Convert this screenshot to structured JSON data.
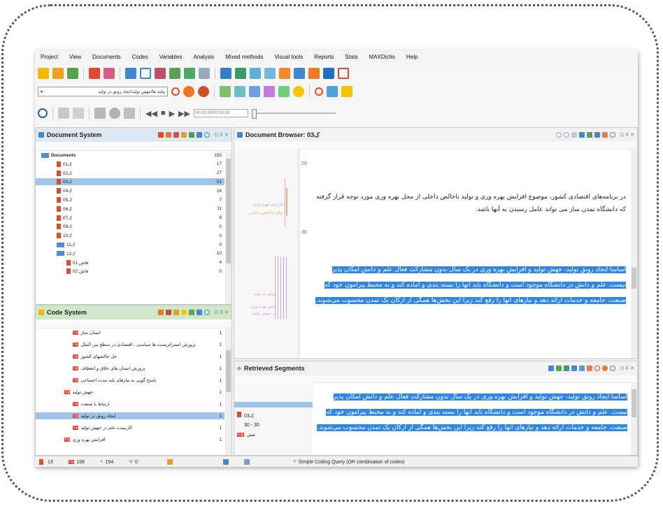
{
  "menu": [
    "Project",
    "View",
    "Documents",
    "Codes",
    "Variables",
    "Analysis",
    "Mixed methods",
    "Visual tools",
    "Reports",
    "Stats",
    "MAXDictio",
    "Help"
  ],
  "code_select": {
    "value": "پیامد ها/جهش تولید/ایجاد رونق در تولید"
  },
  "media": {
    "time": "00:00:00/00:00:00"
  },
  "document_system": {
    "title": "Document System",
    "rows": [
      {
        "label": "Documents",
        "count": "155"
      },
      {
        "label": "01ک",
        "count": "17"
      },
      {
        "label": "02ک",
        "count": "27"
      },
      {
        "label": "03ک",
        "count": "51"
      },
      {
        "label": "04ک",
        "count": "24"
      },
      {
        "label": "05ک",
        "count": "7"
      },
      {
        "label": "06ک",
        "count": "11"
      },
      {
        "label": "07ک",
        "count": "8"
      },
      {
        "label": "09ک",
        "count": "0"
      },
      {
        "label": "10ک",
        "count": "0"
      },
      {
        "label": "11ک",
        "count": "0"
      },
      {
        "label": "12ک",
        "count": "10"
      },
      {
        "label": "فاش 01",
        "count": "4"
      },
      {
        "label": "فاش 02",
        "count": "0"
      }
    ]
  },
  "code_system": {
    "title": "Code System",
    "rows": [
      {
        "label": "انسان ساز",
        "count": "1"
      },
      {
        "label": "پرورش استراتژیست ها سیاسی ، اقتصادی در سطح بین الملل",
        "count": "1"
      },
      {
        "label": "حل چالشهای کشور",
        "count": "1"
      },
      {
        "label": "پرورش انسان های خلاق و انعطاف",
        "count": "1"
      },
      {
        "label": "پاسخ گویی به نیازهای بلند مدت اجتماعی",
        "count": "1"
      },
      {
        "label": "جهش تولید",
        "count": "1"
      },
      {
        "label": "ارتباط با صنعت",
        "count": "1"
      },
      {
        "label": "ایجاد رونق در تولید",
        "count": "1"
      },
      {
        "label": "کاربست علم در جهش تولید",
        "count": "1"
      },
      {
        "label": "افزایش بهره وری",
        "count": "1"
      }
    ]
  },
  "document_browser": {
    "title": "Document Browser: 03ک",
    "para_num_1": "29",
    "para_num_2": "30",
    "paragraph_1": "در برنامه‌های اقتصادی کشور، موضوع افزایش بهره وری و تولید ناخالص داخلی از محل بهره وری مورد توجه قرار گرفته که دانشگاه تمدن ساز می تواند عامل رسیدن به آنها باشد.",
    "paragraph_2": "اساساً ایجاد رونق تولید، جهش تولید و افزایش بهره وری در یک سال بدون مشارکت فعال علم و دانش امکان پذیر نیست. علم و دانش در دانشگاه موجود است و دانشگاه باید آنها را بسته بندی و آماده کند و به محیط پیرامون خود که صنعت، جامعه و خدمات ارائه دهد و نیازهای آنها را رفع کند زیرا این بخش‌ها همگی از ارکان یک تمدن محسوب می‌شوند.",
    "code_label_1": "افزایش بهره وری",
    "code_label_2": "تولید ناخالص داخلی",
    "code_label_3": "رونق در تولید",
    "code_label_4": "نقش بهره وری",
    "code_label_5": "در جهش تولید"
  },
  "retrieved_segments": {
    "title": "Retrieved Segments",
    "doc": "03ک",
    "range": "30 - 30",
    "code_label": "نقش",
    "text": "اساساً ایجاد رونق تولید، جهش تولید و افزایش بهره وری در یک سال بدون مشارکت فعال علم و دانش امکان پذیر نیست. علم و دانش در دانشگاه موجود است و دانشگاه باید آنها را بسته بندی و آماده کند و به محیط پیرامون خود که صنعت، جامعه و خدمات ارائه دهد و نیازهای آنها را رفع کند زیرا این بخش‌ها همگی از ارکان یک تمدن محسوب می‌شوند."
  },
  "status": {
    "docs": "13",
    "codes": "158",
    "memos": "154",
    "var": "0",
    "query": "Simple Coding Query (OR combination of codes)"
  },
  "colors": {
    "accent": "#2e86e6",
    "code_red": "#e53935",
    "header_green": "#cfe9c8"
  }
}
